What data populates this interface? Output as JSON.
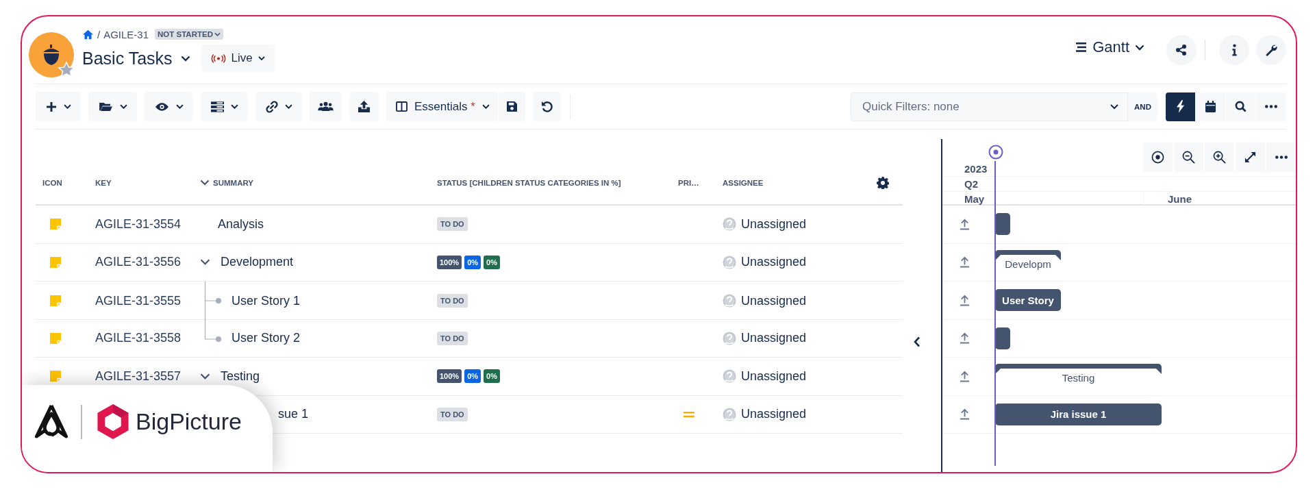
{
  "header": {
    "breadcrumb": {
      "separator": "/",
      "key": "AGILE-31",
      "status": "NOT STARTED"
    },
    "title": "Basic Tasks",
    "mode": "Live",
    "view": "Gantt"
  },
  "toolbar": [
    {
      "kind": "menu"
    },
    {
      "kind": "menu"
    },
    {
      "kind": "menu"
    },
    {
      "kind": "menu"
    },
    {
      "kind": "menu"
    },
    {
      "kind": "icon"
    },
    {
      "kind": "icon"
    },
    {
      "kind": "preset",
      "label": "Essentials",
      "mark": "*"
    },
    {
      "kind": "icon"
    },
    {
      "kind": "icon"
    }
  ],
  "filters": {
    "placeholder": "Quick Filters: none",
    "operator": "AND",
    "tools": [
      {
        "selected": true
      },
      {
        "selected": false
      },
      {
        "selected": false
      },
      {
        "selected": false
      }
    ]
  },
  "table": {
    "columns": [
      "ICON",
      "KEY",
      "SUMMARY",
      "STATUS [CHILDREN STATUS CATEGORIES IN %]",
      "PRI…",
      "ASSIGNEE"
    ],
    "rows": [
      {
        "key": "AGILE-31-3554",
        "summary": "Analysis",
        "status": {
          "kind": "label",
          "label": "TO DO"
        },
        "assignee": "Unassigned",
        "bar": {
          "kind": "task"
        }
      },
      {
        "key": "AGILE-31-3556",
        "summary": "Development",
        "expanded": true,
        "status": {
          "kind": "progress",
          "parts": [
            {
              "label": "100%",
              "color": "#44546f"
            },
            {
              "label": "0%",
              "color": "#0c66e4"
            },
            {
              "label": "0%",
              "color": "#216e4e"
            }
          ]
        },
        "assignee": "Unassigned",
        "bar": {
          "kind": "summary",
          "label": "Developm"
        },
        "children": [
          {
            "key": "AGILE-31-3555",
            "summary": "User Story 1",
            "status": {
              "kind": "label",
              "label": "TO DO"
            },
            "assignee": "Unassigned",
            "bar": {
              "kind": "task",
              "label": "User Story"
            }
          },
          {
            "key": "AGILE-31-3558",
            "summary": "User Story 2",
            "status": {
              "kind": "label",
              "label": "TO DO"
            },
            "assignee": "Unassigned",
            "bar": {
              "kind": "task"
            }
          }
        ]
      },
      {
        "key": "AGILE-31-3557",
        "summary": "Testing",
        "expanded": true,
        "status": {
          "kind": "progress",
          "parts": [
            {
              "label": "100%",
              "color": "#44546f"
            },
            {
              "label": "0%",
              "color": "#0c66e4"
            },
            {
              "label": "0%",
              "color": "#216e4e"
            }
          ]
        },
        "assignee": "Unassigned",
        "bar": {
          "kind": "summary",
          "label": "Testing"
        },
        "children": [
          {
            "summary": "sue 1",
            "priority": {
              "kind": "medium"
            },
            "status": {
              "kind": "label",
              "label": "TO DO"
            },
            "assignee": "Unassigned",
            "bar": {
              "kind": "task",
              "label": "Jira issue 1"
            }
          }
        ]
      }
    ]
  },
  "gantt": {
    "year": "2023",
    "quarter": "Q2",
    "months": [
      "May",
      "June"
    ]
  },
  "brand": {
    "name": "BigPicture"
  }
}
